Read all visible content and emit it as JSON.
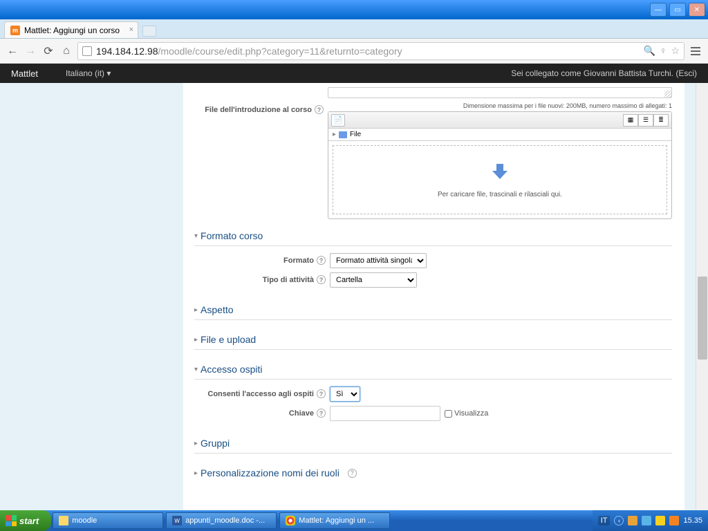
{
  "window": {
    "tab_title": "Mattlet: Aggiungi un corso"
  },
  "browser": {
    "url_domain": "194.184.12.98",
    "url_path": "/moodle/course/edit.php?category=11&returnto=category"
  },
  "header": {
    "brand": "Mattlet",
    "language": "Italiano (it) ▾",
    "login_prefix": "Sei collegato come ",
    "user_name": "Giovanni Battista Turchi",
    "logout": "Esci"
  },
  "form": {
    "intro_files_label": "File dell'introduzione al corso",
    "filesize_note": "Dimensione massima per i file nuovi: 200MB, numero massimo di allegati: 1",
    "file_root": "File",
    "drop_hint": "Per caricare file, trascinali e rilasciali qui."
  },
  "sections": {
    "formato_corso": "Formato corso",
    "aspetto": "Aspetto",
    "file_upload": "File e upload",
    "accesso_ospiti": "Accesso ospiti",
    "gruppi": "Gruppi",
    "personalizzazione": "Personalizzazione nomi dei ruoli"
  },
  "fields": {
    "formato_label": "Formato",
    "formato_value": "Formato attività singola",
    "tipo_label": "Tipo di attività",
    "tipo_value": "Cartella",
    "consenti_label": "Consenti l'accesso agli ospiti",
    "consenti_value": "Sì",
    "chiave_label": "Chiave",
    "visualizza_label": "Visualizza"
  },
  "taskbar": {
    "start": "start",
    "item1": "moodle",
    "item2": "appunti_moodle.doc -...",
    "item3": "Mattlet: Aggiungi un ...",
    "lang": "IT",
    "clock": "15.35"
  }
}
